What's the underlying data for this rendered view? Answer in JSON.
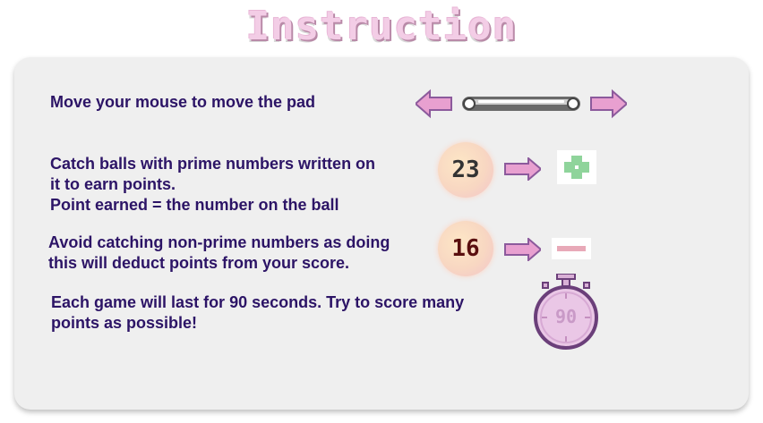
{
  "title": "Instruction",
  "rules": [
    {
      "text": "Move your mouse to move the pad"
    },
    {
      "text": "Catch balls with prime numbers written on\nit to earn points.\nPoint earned = the number on the ball",
      "ball_number": "23"
    },
    {
      "text": "Avoid catching non-prime numbers as doing\nthis will deduct points from your score.",
      "ball_number": "16"
    },
    {
      "text": "Each game will last for 90 seconds. Try to score many\npoints as possible!",
      "timer_value": "90"
    }
  ],
  "colors": {
    "text": "#2c1466",
    "arrow": "#e8a0d0",
    "plus": "#8fd49b",
    "minus": "#e8a9b8",
    "timer": "#eac7e6"
  }
}
